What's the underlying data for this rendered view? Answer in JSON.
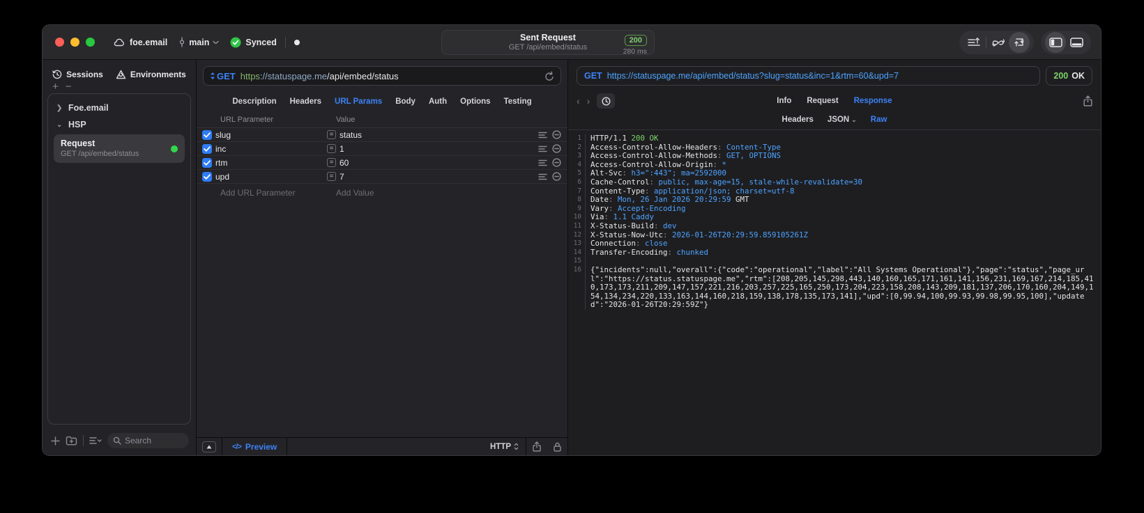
{
  "colors": {
    "accent_blue": "#3d82f6",
    "link_blue": "#4da3ff",
    "status_green": "#7ed36a",
    "sync_green": "#32d74b"
  },
  "titlebar": {
    "project": "foe.email",
    "branch": "main",
    "sync_status": "Synced",
    "request_title": "Sent Request",
    "request_subtitle": "GET /api/embed/status",
    "status_code": "200",
    "duration": "280 ms"
  },
  "sidebar": {
    "tabs": [
      {
        "label": "Sessions",
        "icon": "history-clock-icon"
      },
      {
        "label": "Environments",
        "icon": "environments-icon"
      }
    ],
    "tree": [
      {
        "label": "Foe.email",
        "expanded": false
      },
      {
        "label": "HSP",
        "expanded": true
      }
    ],
    "request_item": {
      "title": "Request",
      "subtitle": "GET /api/embed/status"
    },
    "search_placeholder": "Search"
  },
  "request_pane": {
    "method": "GET",
    "url_scheme": "https",
    "url_host": "://statuspage.me",
    "url_path": "/api/embed/status",
    "tabs": [
      "Description",
      "Headers",
      "URL Params",
      "Body",
      "Auth",
      "Options",
      "Testing"
    ],
    "active_tab": "URL Params",
    "params_header": {
      "name": "URL Parameter",
      "value": "Value"
    },
    "params": [
      {
        "name": "slug",
        "value": "status",
        "enabled": true
      },
      {
        "name": "inc",
        "value": "1",
        "enabled": true
      },
      {
        "name": "rtm",
        "value": "60",
        "enabled": true
      },
      {
        "name": "upd",
        "value": "7",
        "enabled": true
      }
    ],
    "add_param_label": "Add URL Parameter",
    "add_value_label": "Add Value",
    "footer": {
      "preview_label": "Preview",
      "code_glyph": "</>",
      "protocol": "HTTP"
    }
  },
  "response_pane": {
    "method": "GET",
    "url": "https://statuspage.me/api/embed/status?slug=status&inc=1&rtm=60&upd=7",
    "status_code": "200",
    "status_text": "OK",
    "tabs": [
      "Info",
      "Request",
      "Response"
    ],
    "active_tab": "Response",
    "subtabs": [
      "Headers",
      "JSON",
      "Raw"
    ],
    "active_subtab": "Raw",
    "lines": [
      {
        "n": "1",
        "type": "status",
        "plain": "HTTP/1.1 ",
        "green": "200 OK"
      },
      {
        "n": "2",
        "type": "header",
        "key": "Access-Control-Allow-Headers",
        "value": "Content-Type"
      },
      {
        "n": "3",
        "type": "header",
        "key": "Access-Control-Allow-Methods",
        "value": "GET, OPTIONS"
      },
      {
        "n": "4",
        "type": "header",
        "key": "Access-Control-Allow-Origin",
        "value": "*"
      },
      {
        "n": "5",
        "type": "header",
        "key": "Alt-Svc",
        "value": "h3=\":443\"; ma=2592000"
      },
      {
        "n": "6",
        "type": "header",
        "key": "Cache-Control",
        "value": "public, max-age=15, stale-while-revalidate=30"
      },
      {
        "n": "7",
        "type": "header",
        "key": "Content-Type",
        "value": "application/json; charset=utf-8"
      },
      {
        "n": "8",
        "type": "header",
        "key": "Date",
        "value": "Mon, 26 Jan 2026 20:29:59",
        "suffix": " GMT"
      },
      {
        "n": "9",
        "type": "header",
        "key": "Vary",
        "value": "Accept-Encoding"
      },
      {
        "n": "10",
        "type": "header",
        "key": "Via",
        "value": "1.1 Caddy"
      },
      {
        "n": "11",
        "type": "header",
        "key": "X-Status-Build",
        "value": "dev"
      },
      {
        "n": "12",
        "type": "header",
        "key": "X-Status-Now-Utc",
        "value": "2026-01-26T20:29:59.859105261Z"
      },
      {
        "n": "13",
        "type": "header",
        "key": "Connection",
        "value": "close"
      },
      {
        "n": "14",
        "type": "header",
        "key": "Transfer-Encoding",
        "value": "chunked"
      },
      {
        "n": "15",
        "type": "blank"
      },
      {
        "n": "16",
        "type": "body",
        "text": "{\"incidents\":null,\"overall\":{\"code\":\"operational\",\"label\":\"All Systems Operational\"},\"page\":\"status\",\"page_url\":\"https://status.statuspage.me\",\"rtm\":[208,205,145,298,443,140,160,165,171,161,141,156,231,169,167,214,185,410,173,173,211,209,147,157,221,216,203,257,225,165,250,173,204,223,158,208,143,209,181,137,206,170,160,204,149,154,134,234,220,133,163,144,160,218,159,138,178,135,173,141],\"upd\":[0,99.94,100,99.93,99.98,99.95,100],\"updated\":\"2026-01-26T20:29:59Z\"}"
      }
    ]
  }
}
